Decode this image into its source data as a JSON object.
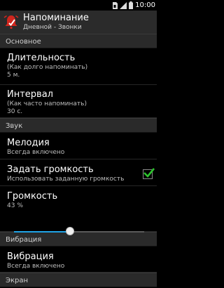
{
  "status_bar": {
    "time": "10:00"
  },
  "action_bar": {
    "title": "Напоминание",
    "subtitle": "Дневной - Звонки",
    "accent_color": "#d0261e"
  },
  "sections": {
    "main": {
      "label": "Основное"
    },
    "sound": {
      "label": "Звук"
    },
    "vibration": {
      "label": "Вибрация"
    },
    "screen": {
      "label": "Экран"
    }
  },
  "items": {
    "duration": {
      "title": "Длительность",
      "hint": "(Как долго напоминать)",
      "value": "5 м."
    },
    "interval": {
      "title": "Интервал",
      "hint": "(Как часто напоминать)",
      "value": "30 с."
    },
    "melody": {
      "title": "Мелодия",
      "summary": "Всегда включено"
    },
    "set_volume": {
      "title": "Задать громкость",
      "summary": "Использовать заданную громкость",
      "checked": true
    },
    "volume": {
      "title": "Громкость",
      "value": "43  %",
      "level_percent": 43,
      "accent_color": "#1fa3e6"
    },
    "vibration": {
      "title": "Вибрация",
      "summary": "Всегда включено"
    }
  },
  "icons": {
    "app": "bell-icon",
    "status": [
      "sim-icon",
      "signal-icon",
      "battery-icon"
    ],
    "check": "check-icon"
  }
}
